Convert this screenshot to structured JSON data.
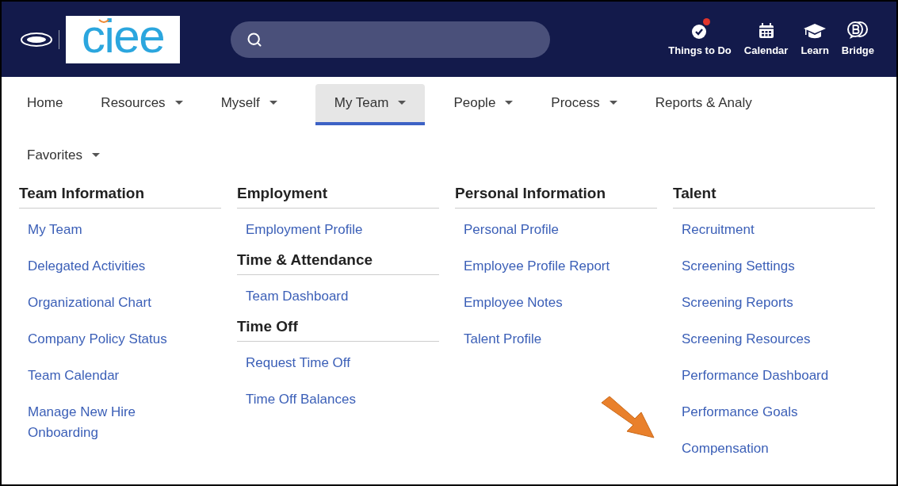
{
  "header": {
    "logo_text": "ciee",
    "actions": [
      {
        "label": "Things to Do",
        "kind": "todo",
        "badge": true
      },
      {
        "label": "Calendar",
        "kind": "calendar",
        "badge": false
      },
      {
        "label": "Learn",
        "kind": "learn",
        "badge": false
      },
      {
        "label": "Bridge",
        "kind": "bridge",
        "badge": false
      }
    ]
  },
  "nav": {
    "rows": [
      [
        {
          "label": "Home",
          "dropdown": false,
          "selected": false
        },
        {
          "label": "Resources",
          "dropdown": true,
          "selected": false
        },
        {
          "label": "Myself",
          "dropdown": true,
          "selected": false
        },
        {
          "label": "My Team",
          "dropdown": true,
          "selected": true
        },
        {
          "label": "People",
          "dropdown": true,
          "selected": false
        },
        {
          "label": "Process",
          "dropdown": true,
          "selected": false
        },
        {
          "label": "Reports & Analy",
          "dropdown": false,
          "selected": false
        }
      ],
      [
        {
          "label": "Favorites",
          "dropdown": true,
          "selected": false
        }
      ]
    ]
  },
  "menu": {
    "columns": [
      {
        "sections": [
          {
            "heading": "Team Information",
            "items": [
              "My Team",
              "Delegated Activities",
              "Organizational Chart",
              "Company Policy Status",
              "Team Calendar",
              "Manage New Hire Onboarding"
            ]
          }
        ]
      },
      {
        "sections": [
          {
            "heading": "Employment",
            "items": [
              "Employment Profile"
            ]
          },
          {
            "heading": "Time & Attendance",
            "items": [
              "Team Dashboard"
            ]
          },
          {
            "heading": "Time Off",
            "items": [
              "Request Time Off",
              "Time Off Balances"
            ]
          }
        ]
      },
      {
        "sections": [
          {
            "heading": "Personal Information",
            "items": [
              "Personal Profile",
              "Employee Profile Report",
              "Employee Notes",
              "Talent Profile"
            ]
          }
        ]
      },
      {
        "sections": [
          {
            "heading": "Talent",
            "items": [
              "Recruitment",
              "Screening Settings",
              "Screening Reports",
              "Screening Resources",
              "Performance Dashboard",
              "Performance Goals",
              "Compensation"
            ]
          }
        ]
      }
    ]
  }
}
